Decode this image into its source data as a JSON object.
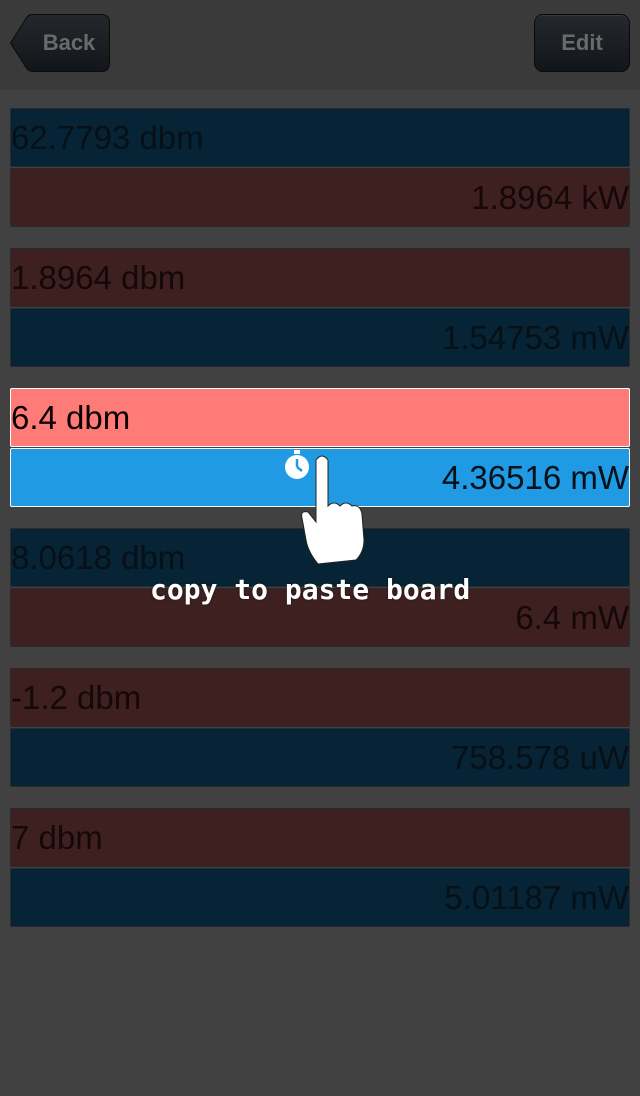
{
  "navbar": {
    "back_label": "Back",
    "edit_label": "Edit"
  },
  "conversions": [
    {
      "input": "62.7793 dbm",
      "output": "1.8964 kW"
    },
    {
      "input": "1.8964 dbm",
      "output": "1.54753 mW"
    },
    {
      "input": "6.4 dbm",
      "output": "4.36516 mW"
    },
    {
      "input": "8.0618 dbm",
      "output": "6.4 mW"
    },
    {
      "input": "-1.2 dbm",
      "output": "758.578 uW"
    },
    {
      "input": "7 dbm",
      "output": "5.01187 mW"
    }
  ],
  "overlay": {
    "hint": "copy to paste board",
    "icons": [
      "stopwatch-icon",
      "pointing-hand-icon"
    ]
  },
  "colors": {
    "background": "#414141",
    "navy_row": "#072436",
    "maroon_row": "#3f2020",
    "highlight_input": "#ff7b78",
    "highlight_output": "#1f9ae3"
  }
}
